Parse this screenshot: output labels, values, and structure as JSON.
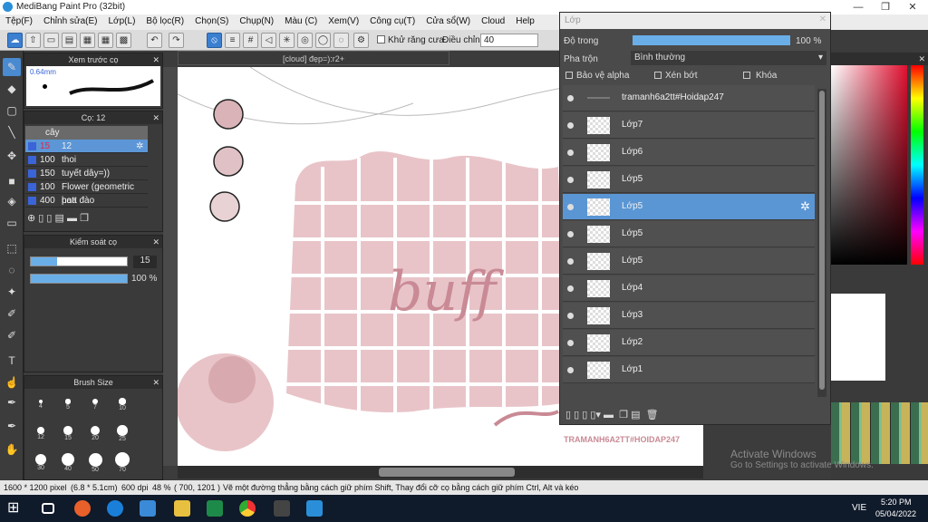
{
  "window": {
    "title": "MediBang Paint Pro (32bit)",
    "minimize": "—",
    "maximize": "❐",
    "close": "✕"
  },
  "menu": [
    "Tệp(F)",
    "Chỉnh sửa(E)",
    "Lớp(L)",
    "Bộ lọc(R)",
    "Chọn(S)",
    "Chụp(N)",
    "Màu (C)",
    "Xem(V)",
    "Công cụ(T)",
    "Cửa sổ(W)",
    "Cloud",
    "Help"
  ],
  "toolbar": {
    "antialias_label": "Khử răng cưa",
    "adjust_label": "Điều chỉnh",
    "adjust_value": "40"
  },
  "preview_panel": {
    "title": "Xem trước cọ",
    "size": "0.64mm"
  },
  "brush_panel": {
    "title": "Cọ: 12",
    "group": "cây",
    "brushes": [
      {
        "size": "15",
        "name": "12",
        "selected": true
      },
      {
        "size": "100",
        "name": "thoi"
      },
      {
        "size": "150",
        "name": "tuyết dây=))"
      },
      {
        "size": "100",
        "name": "Flower (geometric patt"
      },
      {
        "size": "400",
        "name": "hoa đào"
      }
    ]
  },
  "brush_control": {
    "title": "Kiểm soát cọ",
    "size_value": "15",
    "opacity_value": "100 %",
    "size_fraction": 0.27,
    "opacity_fraction": 1.0
  },
  "brush_size": {
    "title": "Brush Size",
    "labels": [
      "4",
      "5",
      "7",
      "10",
      "12",
      "15",
      "20",
      "25",
      "30",
      "40",
      "50",
      "70"
    ]
  },
  "document": {
    "tab": "[cloud] đẹp=):r2+",
    "watermark": "TRAMANH6A2TT#HOIDAP247",
    "art_text": "buff"
  },
  "layer_panel": {
    "title": "Lớp",
    "opacity_label": "Độ trong",
    "opacity_value": "100 %",
    "blend_label": "Pha trộn",
    "blend_value": "Bình thường",
    "protect_alpha": "Bảo vệ alpha",
    "clipping": "Xén bớt",
    "lock": "Khóa",
    "layers": [
      {
        "name": "tramanh6a2tt#Hoidap247",
        "folder": true
      },
      {
        "name": "Lớp7"
      },
      {
        "name": "Lớp6"
      },
      {
        "name": "Lớp5"
      },
      {
        "name": "Lớp5",
        "selected": true
      },
      {
        "name": "Lớp5"
      },
      {
        "name": "Lớp5"
      },
      {
        "name": "Lớp4"
      },
      {
        "name": "Lớp3"
      },
      {
        "name": "Lớp2"
      },
      {
        "name": "Lớp1"
      }
    ]
  },
  "windows_notice": {
    "title": "Activate Windows",
    "text": "Go to Settings to activate Windows."
  },
  "status": {
    "size": "1600 * 1200 pixel",
    "cm": "(6.8 * 5.1cm)",
    "dpi": "600 dpi",
    "zoom": "48 %",
    "coords": "( 700, 1201 )",
    "hint": "Vẽ một đường thẳng bằng cách giữ phím Shift, Thay đổi cỡ cọ bằng cách giữ phím Ctrl, Alt và kéo"
  },
  "taskbar": {
    "lang": "VIE",
    "time": "5:20 PM",
    "date": "05/04/2022"
  },
  "colors": {
    "accent": "#5a96d4",
    "pink": "#e8c4c8",
    "darkpink": "#c98a95"
  }
}
